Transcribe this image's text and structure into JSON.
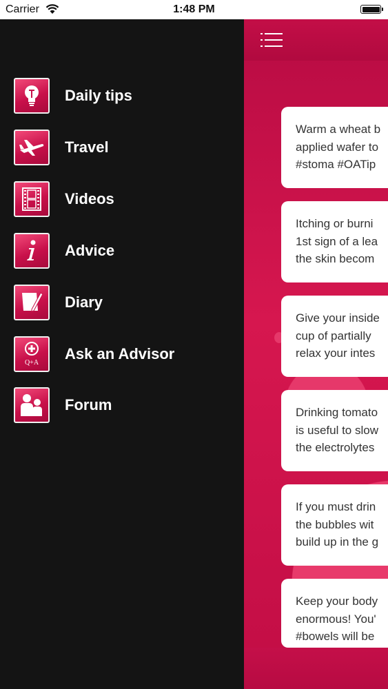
{
  "status_bar": {
    "carrier": "Carrier",
    "time": "1:48 PM"
  },
  "menu": {
    "items": [
      {
        "label": "Daily tips",
        "icon": "lightbulb-icon"
      },
      {
        "label": "Travel",
        "icon": "airplane-icon"
      },
      {
        "label": "Videos",
        "icon": "film-strip-icon"
      },
      {
        "label": "Advice",
        "icon": "info-icon"
      },
      {
        "label": "Diary",
        "icon": "notepad-pen-icon"
      },
      {
        "label": "Ask an Advisor",
        "icon": "qa-icon",
        "icon_text": "Q+A"
      },
      {
        "label": "Forum",
        "icon": "people-icon"
      }
    ]
  },
  "tips": [
    {
      "text": "Warm a wheat b\napplied wafer to\n#stoma #OATip"
    },
    {
      "text": "Itching or burni\n1st sign of a lea\nthe skin becom"
    },
    {
      "text": "Give your inside\ncup of partially\nrelax your intes"
    },
    {
      "text": "Drinking tomato\nis useful to slow\nthe electrolytes"
    },
    {
      "text": "If you must drin\nthe bubbles wit\nbuild up in the g"
    },
    {
      "text": "Keep your body\nenormous! You'\n#bowels will be"
    }
  ],
  "colors": {
    "accent": "#c8104a",
    "drawer": "#141414",
    "card": "#ffffff"
  }
}
